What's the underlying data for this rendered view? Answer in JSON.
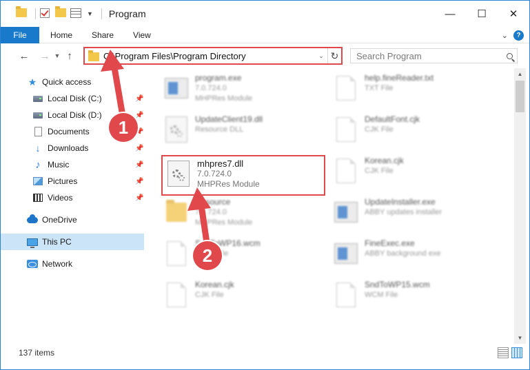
{
  "window": {
    "title": "Program",
    "controls": {
      "minimize": "—",
      "maximize": "☐",
      "close": "✕"
    }
  },
  "ribbon": {
    "file": "File",
    "tabs": [
      "Home",
      "Share",
      "View"
    ],
    "help": "?"
  },
  "address": {
    "path": "C:\\Program Files\\Program Directory",
    "search_placeholder": "Search Program"
  },
  "sidebar": {
    "items": [
      {
        "label": "Quick access",
        "icon": "star-icon"
      },
      {
        "label": "Local Disk (C:)",
        "icon": "disk-icon",
        "pinned": true
      },
      {
        "label": "Local Disk (D:)",
        "icon": "disk-icon",
        "pinned": true
      },
      {
        "label": "Documents",
        "icon": "documents-icon",
        "pinned": true
      },
      {
        "label": "Downloads",
        "icon": "download-icon",
        "pinned": true
      },
      {
        "label": "Music",
        "icon": "music-icon",
        "pinned": true
      },
      {
        "label": "Pictures",
        "icon": "pictures-icon",
        "pinned": true
      },
      {
        "label": "Videos",
        "icon": "videos-icon",
        "pinned": true
      },
      {
        "label": "OneDrive",
        "icon": "cloud-icon"
      },
      {
        "label": "This PC",
        "icon": "pc-icon",
        "selected": true
      },
      {
        "label": "Network",
        "icon": "network-icon"
      }
    ]
  },
  "files": [
    {
      "name": "program.exe",
      "sub1": "7.0.724.0",
      "sub2": "MHPRes Module"
    },
    {
      "name": "help.fineReader.txt",
      "sub1": "TXT File",
      "sub2": ""
    },
    {
      "name": "UpdateClient19.dll",
      "sub1": "Resource DLL",
      "sub2": ""
    },
    {
      "name": "DefaultFont.cjk",
      "sub1": "CJK File",
      "sub2": ""
    },
    {
      "name": "mhpres7.dll",
      "sub1": "7.0.724.0",
      "sub2": "MHPRes Module"
    },
    {
      "name": "Korean.cjk",
      "sub1": "CJK File",
      "sub2": ""
    },
    {
      "name": "Resource",
      "sub1": "7.0.724.0",
      "sub2": "MHPRes Module"
    },
    {
      "name": "UpdateInstaller.exe",
      "sub1": "ABBY updates installer",
      "sub2": ""
    },
    {
      "name": "SndToWP16.wcm",
      "sub1": "WCM File",
      "sub2": ""
    },
    {
      "name": "FineExec.exe",
      "sub1": "ABBY background exe",
      "sub2": ""
    },
    {
      "name": "Korean.cjk",
      "sub1": "CJK File",
      "sub2": ""
    },
    {
      "name": "SndToWP15.wcm",
      "sub1": "WCM File",
      "sub2": ""
    }
  ],
  "status": {
    "count": "137 items"
  },
  "annotations": {
    "step1": "1",
    "step2": "2",
    "color": "#e0484b"
  }
}
